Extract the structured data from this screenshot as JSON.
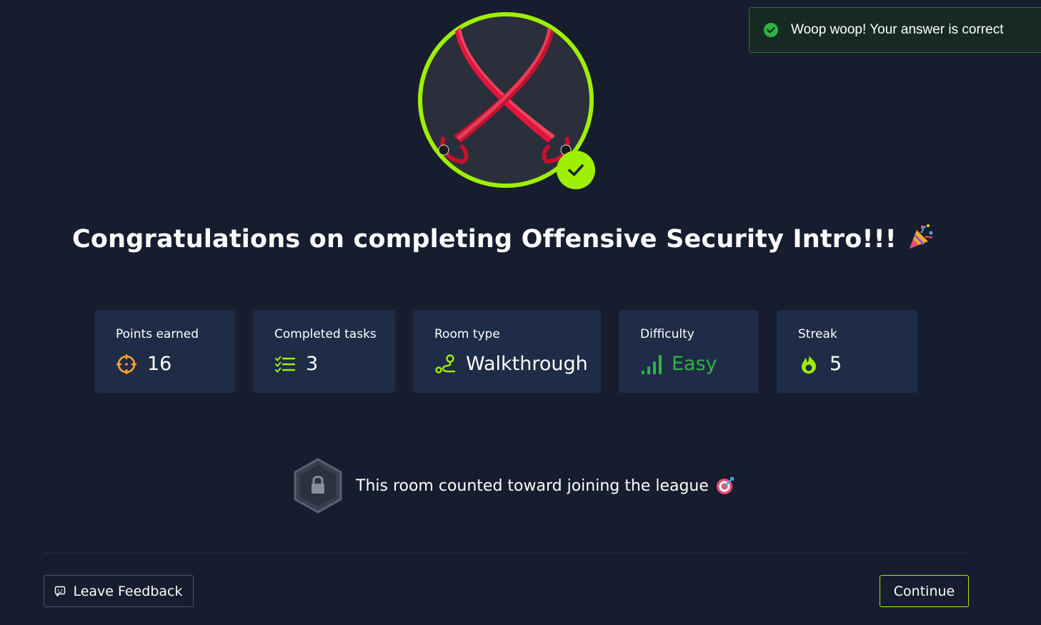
{
  "toast": {
    "message": "Woop woop! Your answer is correct",
    "icon": "check-circle-icon",
    "color": "#2fb344"
  },
  "badge": {
    "icon": "crossed-swords-icon",
    "ring_color": "#9fef00",
    "check_icon": "check-icon"
  },
  "title": {
    "text": "Congratulations on completing Offensive Security Intro!!!",
    "emoji_icon": "party-popper-icon"
  },
  "stats": [
    {
      "label": "Points earned",
      "value": "16",
      "icon": "crosshair-icon",
      "icon_color": "#ffa336"
    },
    {
      "label": "Completed tasks",
      "value": "3",
      "icon": "checklist-icon",
      "icon_color": "#9fef00"
    },
    {
      "label": "Room type",
      "value": "Walkthrough",
      "icon": "route-icon",
      "icon_color": "#9fef00"
    },
    {
      "label": "Difficulty",
      "value": "Easy",
      "icon": "signal-bars-icon",
      "icon_color": "#2fb344"
    },
    {
      "label": "Streak",
      "value": "5",
      "icon": "flame-icon",
      "icon_color": "#9fef00"
    }
  ],
  "league": {
    "text": "This room counted toward joining the league",
    "icon": "locked-hexagon-icon",
    "emoji_icon": "target-icon"
  },
  "footer": {
    "feedback_label": "Leave Feedback",
    "feedback_icon": "feedback-icon",
    "continue_label": "Continue",
    "accent": "#9fef00"
  }
}
